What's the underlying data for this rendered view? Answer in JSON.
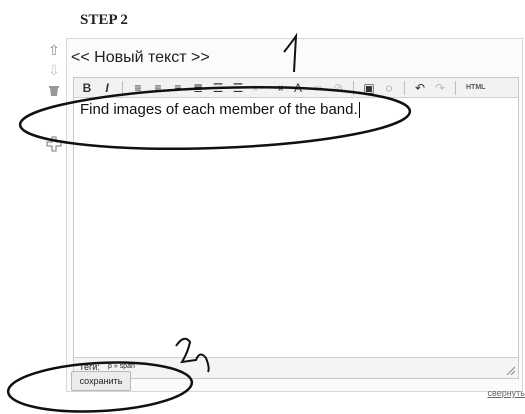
{
  "step_title": "STEP 2",
  "panel": {
    "title": "<< Новый текст >>"
  },
  "side_toolbar": {
    "icons": [
      "arrow-up-icon",
      "arrow-down-icon",
      "delete-icon",
      "add-icon"
    ]
  },
  "toolbar": {
    "bold": "B",
    "italic": "I",
    "html_label": "HTML"
  },
  "editor": {
    "content": "Find  images of each member of the band."
  },
  "status": {
    "tags_label": "Теги:",
    "path": "p » span"
  },
  "buttons": {
    "save": "сохранить",
    "collapse": "свернуть"
  },
  "annotations": {
    "label_1": "1",
    "label_2": "2"
  }
}
